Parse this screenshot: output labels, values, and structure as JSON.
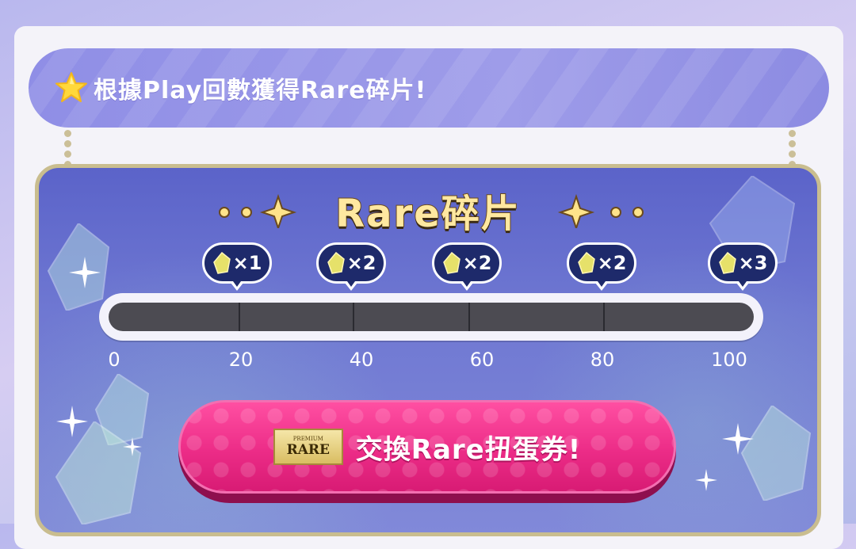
{
  "header": {
    "title": "根據Play回數獲得Rare碎片!",
    "icon": "star-icon"
  },
  "panel": {
    "title": "Rare碎片",
    "rewards": [
      {
        "icon": "crystal-fragment-icon",
        "qty": "×1",
        "at": 20
      },
      {
        "icon": "crystal-fragment-icon",
        "qty": "×2",
        "at": 40
      },
      {
        "icon": "crystal-fragment-icon",
        "qty": "×2",
        "at": 60
      },
      {
        "icon": "crystal-fragment-icon",
        "qty": "×2",
        "at": 80
      },
      {
        "icon": "crystal-fragment-icon",
        "qty": "×3",
        "at": 100
      }
    ],
    "progress": {
      "value": 0,
      "max": 100
    },
    "scale": [
      "0",
      "20",
      "40",
      "60",
      "80",
      "100"
    ]
  },
  "exchange_button": {
    "label": "交換Rare扭蛋券!",
    "ticket_small": "PREMIUM",
    "ticket_large": "RARE"
  },
  "colors": {
    "header": "#9e9ce9",
    "panel": "#6f78d2",
    "gold_border": "#c9bd8f",
    "button": "#ec2c87",
    "reward_bubble": "#1e2a6b"
  }
}
